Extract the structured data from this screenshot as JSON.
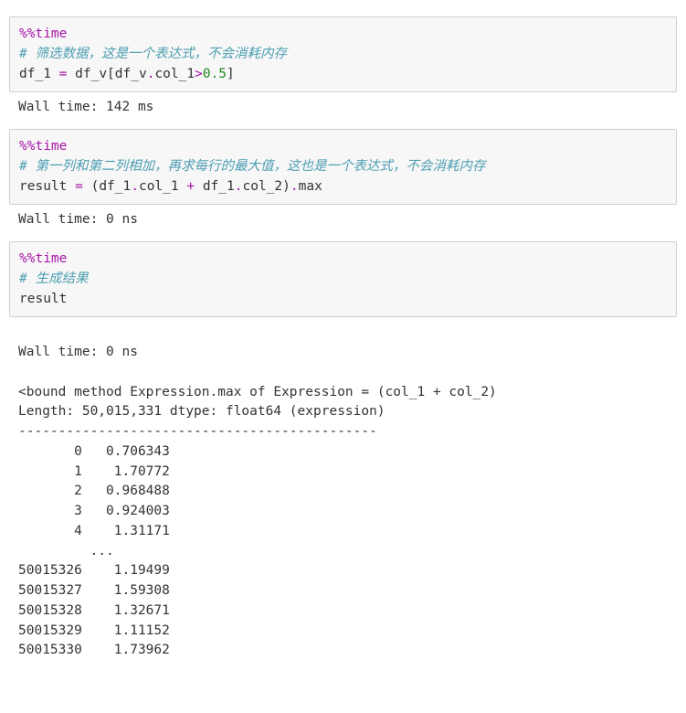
{
  "cell1": {
    "magic": "%%time",
    "comment": "# 筛选数据，这是一个表达式，不会消耗内存",
    "code": {
      "p1": "df_1 ",
      "eq": "= ",
      "p2": "df_v[df_v",
      "dot1": ".",
      "a1": "col_1",
      "gt": ">",
      "n1": "0.5",
      "p3": "]"
    },
    "out": "Wall time: 142 ms"
  },
  "cell2": {
    "magic": "%%time",
    "comment": "# 第一列和第二列相加，再求每行的最大值，这也是一个表达式，不会消耗内存",
    "code": {
      "p1": "result ",
      "eq": "= ",
      "lp": "(",
      "d1": "df_1",
      "dot1": ".",
      "a1": "col_1 ",
      "plus": "+ ",
      "d2": "df_1",
      "dot2": ".",
      "a2": "col_2",
      "rp": ")",
      "dot3": ".",
      "mx": "max"
    },
    "out": "Wall time: 0 ns"
  },
  "cell3": {
    "magic": "%%time",
    "comment": "# 生成结果",
    "code": "result",
    "out1": "Wall time: 0 ns",
    "out2": "<bound method Expression.max of Expression = (col_1 + col_2)",
    "out3": "Length: 50,015,331 dtype: float64 (expression)",
    "dash": "---------------------------------------------",
    "rows_head": [
      "       0   0.706343",
      "       1    1.70772",
      "       2   0.968488",
      "       3   0.924003",
      "       4    1.31171",
      "         ..."
    ],
    "rows_tail": [
      "50015326    1.19499",
      "50015327    1.59308",
      "50015328    1.32671",
      "50015329    1.11152",
      "50015330    1.73962"
    ]
  }
}
